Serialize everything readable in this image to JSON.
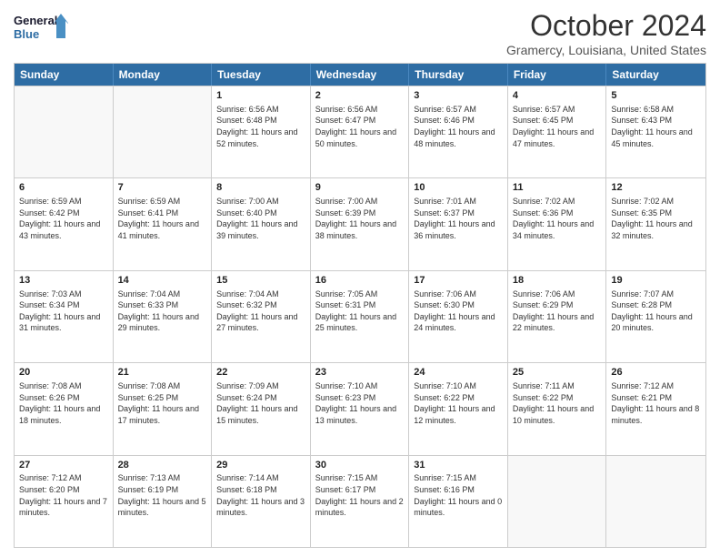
{
  "header": {
    "logo_line1": "General",
    "logo_line2": "Blue",
    "month": "October 2024",
    "location": "Gramercy, Louisiana, United States"
  },
  "weekdays": [
    "Sunday",
    "Monday",
    "Tuesday",
    "Wednesday",
    "Thursday",
    "Friday",
    "Saturday"
  ],
  "rows": [
    [
      {
        "day": "",
        "sunrise": "",
        "sunset": "",
        "daylight": ""
      },
      {
        "day": "",
        "sunrise": "",
        "sunset": "",
        "daylight": ""
      },
      {
        "day": "1",
        "sunrise": "Sunrise: 6:56 AM",
        "sunset": "Sunset: 6:48 PM",
        "daylight": "Daylight: 11 hours and 52 minutes."
      },
      {
        "day": "2",
        "sunrise": "Sunrise: 6:56 AM",
        "sunset": "Sunset: 6:47 PM",
        "daylight": "Daylight: 11 hours and 50 minutes."
      },
      {
        "day": "3",
        "sunrise": "Sunrise: 6:57 AM",
        "sunset": "Sunset: 6:46 PM",
        "daylight": "Daylight: 11 hours and 48 minutes."
      },
      {
        "day": "4",
        "sunrise": "Sunrise: 6:57 AM",
        "sunset": "Sunset: 6:45 PM",
        "daylight": "Daylight: 11 hours and 47 minutes."
      },
      {
        "day": "5",
        "sunrise": "Sunrise: 6:58 AM",
        "sunset": "Sunset: 6:43 PM",
        "daylight": "Daylight: 11 hours and 45 minutes."
      }
    ],
    [
      {
        "day": "6",
        "sunrise": "Sunrise: 6:59 AM",
        "sunset": "Sunset: 6:42 PM",
        "daylight": "Daylight: 11 hours and 43 minutes."
      },
      {
        "day": "7",
        "sunrise": "Sunrise: 6:59 AM",
        "sunset": "Sunset: 6:41 PM",
        "daylight": "Daylight: 11 hours and 41 minutes."
      },
      {
        "day": "8",
        "sunrise": "Sunrise: 7:00 AM",
        "sunset": "Sunset: 6:40 PM",
        "daylight": "Daylight: 11 hours and 39 minutes."
      },
      {
        "day": "9",
        "sunrise": "Sunrise: 7:00 AM",
        "sunset": "Sunset: 6:39 PM",
        "daylight": "Daylight: 11 hours and 38 minutes."
      },
      {
        "day": "10",
        "sunrise": "Sunrise: 7:01 AM",
        "sunset": "Sunset: 6:37 PM",
        "daylight": "Daylight: 11 hours and 36 minutes."
      },
      {
        "day": "11",
        "sunrise": "Sunrise: 7:02 AM",
        "sunset": "Sunset: 6:36 PM",
        "daylight": "Daylight: 11 hours and 34 minutes."
      },
      {
        "day": "12",
        "sunrise": "Sunrise: 7:02 AM",
        "sunset": "Sunset: 6:35 PM",
        "daylight": "Daylight: 11 hours and 32 minutes."
      }
    ],
    [
      {
        "day": "13",
        "sunrise": "Sunrise: 7:03 AM",
        "sunset": "Sunset: 6:34 PM",
        "daylight": "Daylight: 11 hours and 31 minutes."
      },
      {
        "day": "14",
        "sunrise": "Sunrise: 7:04 AM",
        "sunset": "Sunset: 6:33 PM",
        "daylight": "Daylight: 11 hours and 29 minutes."
      },
      {
        "day": "15",
        "sunrise": "Sunrise: 7:04 AM",
        "sunset": "Sunset: 6:32 PM",
        "daylight": "Daylight: 11 hours and 27 minutes."
      },
      {
        "day": "16",
        "sunrise": "Sunrise: 7:05 AM",
        "sunset": "Sunset: 6:31 PM",
        "daylight": "Daylight: 11 hours and 25 minutes."
      },
      {
        "day": "17",
        "sunrise": "Sunrise: 7:06 AM",
        "sunset": "Sunset: 6:30 PM",
        "daylight": "Daylight: 11 hours and 24 minutes."
      },
      {
        "day": "18",
        "sunrise": "Sunrise: 7:06 AM",
        "sunset": "Sunset: 6:29 PM",
        "daylight": "Daylight: 11 hours and 22 minutes."
      },
      {
        "day": "19",
        "sunrise": "Sunrise: 7:07 AM",
        "sunset": "Sunset: 6:28 PM",
        "daylight": "Daylight: 11 hours and 20 minutes."
      }
    ],
    [
      {
        "day": "20",
        "sunrise": "Sunrise: 7:08 AM",
        "sunset": "Sunset: 6:26 PM",
        "daylight": "Daylight: 11 hours and 18 minutes."
      },
      {
        "day": "21",
        "sunrise": "Sunrise: 7:08 AM",
        "sunset": "Sunset: 6:25 PM",
        "daylight": "Daylight: 11 hours and 17 minutes."
      },
      {
        "day": "22",
        "sunrise": "Sunrise: 7:09 AM",
        "sunset": "Sunset: 6:24 PM",
        "daylight": "Daylight: 11 hours and 15 minutes."
      },
      {
        "day": "23",
        "sunrise": "Sunrise: 7:10 AM",
        "sunset": "Sunset: 6:23 PM",
        "daylight": "Daylight: 11 hours and 13 minutes."
      },
      {
        "day": "24",
        "sunrise": "Sunrise: 7:10 AM",
        "sunset": "Sunset: 6:22 PM",
        "daylight": "Daylight: 11 hours and 12 minutes."
      },
      {
        "day": "25",
        "sunrise": "Sunrise: 7:11 AM",
        "sunset": "Sunset: 6:22 PM",
        "daylight": "Daylight: 11 hours and 10 minutes."
      },
      {
        "day": "26",
        "sunrise": "Sunrise: 7:12 AM",
        "sunset": "Sunset: 6:21 PM",
        "daylight": "Daylight: 11 hours and 8 minutes."
      }
    ],
    [
      {
        "day": "27",
        "sunrise": "Sunrise: 7:12 AM",
        "sunset": "Sunset: 6:20 PM",
        "daylight": "Daylight: 11 hours and 7 minutes."
      },
      {
        "day": "28",
        "sunrise": "Sunrise: 7:13 AM",
        "sunset": "Sunset: 6:19 PM",
        "daylight": "Daylight: 11 hours and 5 minutes."
      },
      {
        "day": "29",
        "sunrise": "Sunrise: 7:14 AM",
        "sunset": "Sunset: 6:18 PM",
        "daylight": "Daylight: 11 hours and 3 minutes."
      },
      {
        "day": "30",
        "sunrise": "Sunrise: 7:15 AM",
        "sunset": "Sunset: 6:17 PM",
        "daylight": "Daylight: 11 hours and 2 minutes."
      },
      {
        "day": "31",
        "sunrise": "Sunrise: 7:15 AM",
        "sunset": "Sunset: 6:16 PM",
        "daylight": "Daylight: 11 hours and 0 minutes."
      },
      {
        "day": "",
        "sunrise": "",
        "sunset": "",
        "daylight": ""
      },
      {
        "day": "",
        "sunrise": "",
        "sunset": "",
        "daylight": ""
      }
    ]
  ]
}
